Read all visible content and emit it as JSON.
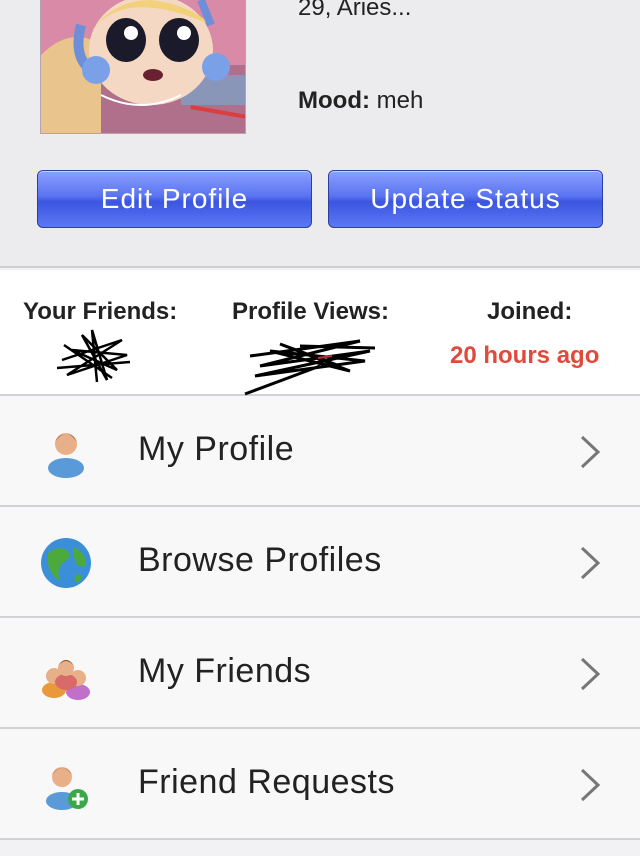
{
  "profile": {
    "age_sign": "29, Aries...",
    "mood_label": "Mood:",
    "mood_value": "meh"
  },
  "buttons": {
    "edit_profile": "Edit Profile",
    "update_status": "Update Status"
  },
  "stats": {
    "friends_label": "Your Friends:",
    "views_label": "Profile Views:",
    "joined_label": "Joined:",
    "joined_value": "20 hours ago"
  },
  "menu": [
    {
      "label": "My Profile",
      "icon": "user-icon"
    },
    {
      "label": "Browse Profiles",
      "icon": "globe-icon"
    },
    {
      "label": "My Friends",
      "icon": "friends-icon"
    },
    {
      "label": "Friend Requests",
      "icon": "add-friend-icon"
    }
  ],
  "colors": {
    "button_blue": "#4a63ea",
    "joined_red": "#e04a3c"
  }
}
